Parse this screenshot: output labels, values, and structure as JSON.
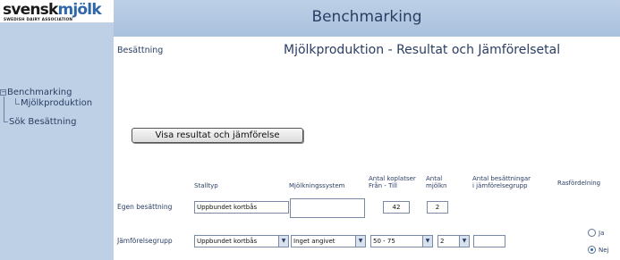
{
  "brand": {
    "logo_text_1": "svensk",
    "logo_text_2": "mjölk",
    "tagline": "SWEDISH DAIRY ASSOCIATION"
  },
  "header": {
    "title": "Benchmarking"
  },
  "sidebar": {
    "items": [
      {
        "label": "Benchmarking"
      },
      {
        "label": "Mjölkproduktion"
      },
      {
        "label": "Sök Besättning"
      }
    ]
  },
  "main": {
    "section_label": "Besättning",
    "heading": "Mjölkproduktion - Resultat och Jämförelsetal",
    "show_button": "Visa resultat och jämförelse",
    "columns": {
      "stalltyp": "Stalltyp",
      "mjolkningssystem": "Mjölkningssystem",
      "koplatser_1": "Antal koplatser",
      "koplatser_2": "Från - Till",
      "mjolkn_1": "Antal",
      "mjolkn_2": "mjölkn",
      "jamforelsegrupp_1": "Antal besättningar",
      "jamforelsegrupp_2": "i jämförelsegrupp",
      "rasfordelning": "Rasfördelning"
    },
    "rows": {
      "egen": {
        "label": "Egen besättning",
        "stalltyp": "Uppbundet kortbås",
        "mjolkningssystem": "",
        "koplatser": "42",
        "mjolkn": "2"
      },
      "jamforelse": {
        "label": "Jämförelsegrupp",
        "stalltyp": "Uppbundet kortbås",
        "mjolkningssystem": "Inget angivet",
        "koplatser": "50 - 75",
        "mjolkn": "2",
        "antal_besattningar": ""
      }
    },
    "rasfordelning": {
      "options": [
        {
          "label": "Ja",
          "checked": false
        },
        {
          "label": "Nej",
          "checked": true
        }
      ]
    }
  }
}
